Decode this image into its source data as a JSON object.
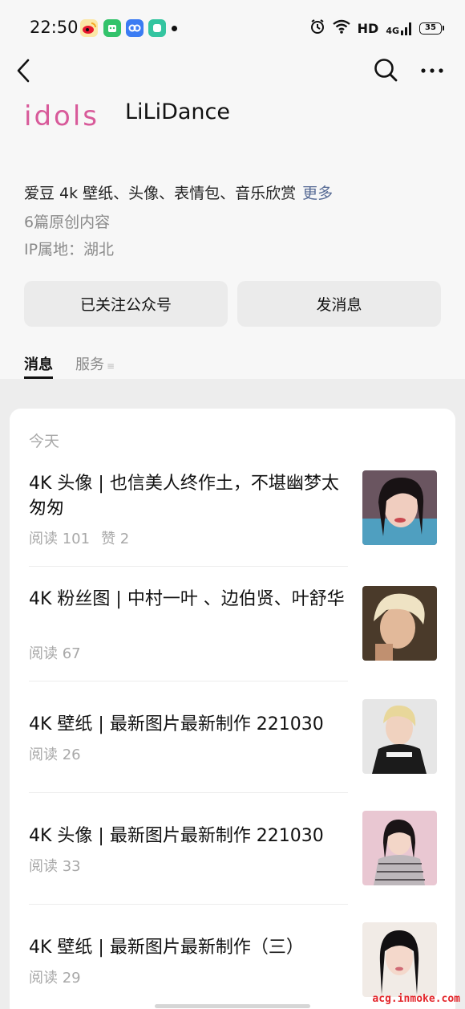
{
  "status_bar": {
    "time": "22:50",
    "hd": "HD",
    "network": "4G",
    "battery": "35"
  },
  "account": {
    "logo_text": "idols",
    "name": "LiLiDance",
    "description": "爱豆 4k 壁纸、头像、表情包、音乐欣赏",
    "more_link": "更多",
    "article_count": "6篇原创内容",
    "ip_location": "IP属地：湖北"
  },
  "buttons": {
    "follow": "已关注公众号",
    "message": "发消息"
  },
  "tabs": [
    {
      "label": "消息"
    },
    {
      "label": "服务"
    }
  ],
  "feed": {
    "day": "今天",
    "articles": [
      {
        "title": "4K 头像 | 也信美人终作土，不堪幽梦太匆匆",
        "reads": "阅读 101",
        "likes": "赞 2"
      },
      {
        "title": "4K 粉丝图 | 中村一叶 、边伯贤、叶舒华",
        "reads": "阅读 67",
        "likes": ""
      },
      {
        "title": "4K 壁纸 | 最新图片最新制作 221030",
        "reads": "阅读 26",
        "likes": ""
      },
      {
        "title": "4K 头像 | 最新图片最新制作 221030",
        "reads": "阅读 33",
        "likes": ""
      },
      {
        "title": "4K 壁纸 | 最新图片最新制作（三）",
        "reads": "阅读 29",
        "likes": ""
      }
    ]
  },
  "watermark": "acg.inmoke.com",
  "colors": {
    "link": "#576b95",
    "watermark": "#e3262b",
    "logo": "#d85a9a"
  }
}
